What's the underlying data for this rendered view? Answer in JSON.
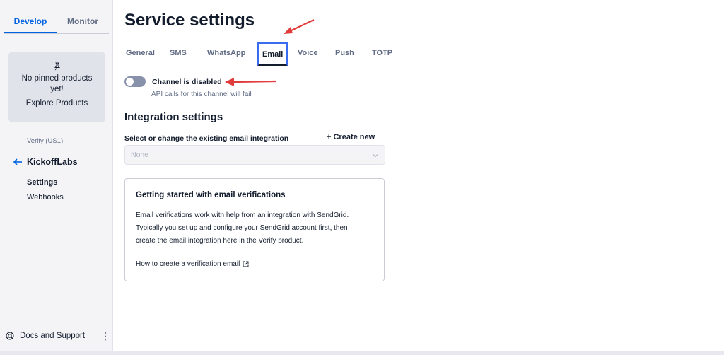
{
  "sidebar": {
    "tabs": [
      {
        "label": "Develop",
        "active": true
      },
      {
        "label": "Monitor",
        "active": false
      }
    ],
    "pinned": {
      "icon": "pin-icon",
      "message": "No pinned products yet!",
      "link": "Explore Products"
    },
    "service_label": "Verify (US1)",
    "back_icon": "arrow-left-icon",
    "service_name": "KickoffLabs",
    "nav": [
      {
        "label": "Settings",
        "active": true
      },
      {
        "label": "Webhooks",
        "active": false
      }
    ],
    "footer": {
      "icon": "support-icon",
      "label": "Docs and Support",
      "menu_icon": "kebab-menu-icon"
    }
  },
  "main": {
    "title": "Service settings",
    "tabs": [
      {
        "label": "General"
      },
      {
        "label": "SMS"
      },
      {
        "label": "WhatsApp"
      },
      {
        "label": "Email",
        "active": true
      },
      {
        "label": "Voice"
      },
      {
        "label": "Push"
      },
      {
        "label": "TOTP"
      }
    ],
    "channel": {
      "enabled": false,
      "label": "Channel is disabled",
      "help": "API calls for this channel will fail"
    },
    "integration": {
      "title": "Integration settings",
      "select_label": "Select or change the existing email integration",
      "create_new": "+ Create new",
      "select_value": "None"
    },
    "card": {
      "title": "Getting started with email verifications",
      "body_lines": [
        "Email verifications work with help from an integration with SendGrid.",
        "Typically you set up and configure your SendGrid account first, then",
        "create the email integration here in the Verify product."
      ],
      "link": "How to create a verification email",
      "link_icon": "external-link-icon"
    }
  },
  "colors": {
    "accent": "#0263e0",
    "active_tab_border": "#3a6cf0",
    "annotation_arrow": "#e23b3b",
    "toggle_off": "#8891aa"
  }
}
